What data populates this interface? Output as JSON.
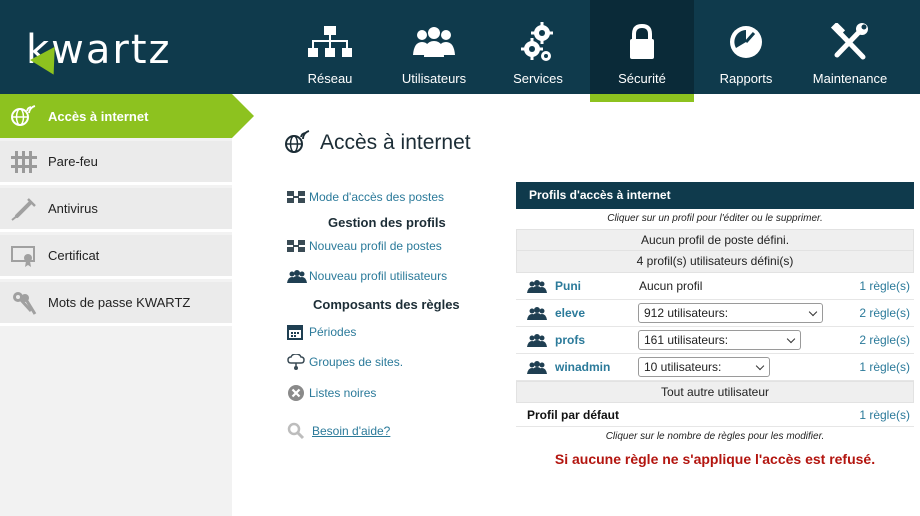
{
  "app": {
    "logo_text": "kwartz"
  },
  "nav": {
    "items": [
      {
        "label": "Réseau",
        "icon": "network-icon"
      },
      {
        "label": "Utilisateurs",
        "icon": "users-icon"
      },
      {
        "label": "Services",
        "icon": "gears-icon"
      },
      {
        "label": "Sécurité",
        "icon": "lock-icon",
        "active": true
      },
      {
        "label": "Rapports",
        "icon": "pie-chart-icon"
      },
      {
        "label": "Maintenance",
        "icon": "tools-icon"
      }
    ]
  },
  "sidebar": {
    "items": [
      {
        "label": "Accès à internet",
        "icon": "globe-icon",
        "active": true
      },
      {
        "label": "Pare-feu",
        "icon": "firewall-icon"
      },
      {
        "label": "Antivirus",
        "icon": "syringe-icon"
      },
      {
        "label": "Certificat",
        "icon": "certificate-icon"
      },
      {
        "label": "Mots de passe KWARTZ",
        "icon": "keys-icon"
      }
    ]
  },
  "page": {
    "title": "Accès à internet"
  },
  "left_menu": {
    "mode_acces": "Mode d'accès des postes",
    "gestion_title": "Gestion des profils",
    "nouveau_postes": "Nouveau profil de postes",
    "nouveau_utilisateurs": "Nouveau profil utilisateurs",
    "composants_title": "Composants des règles",
    "periodes": "Périodes",
    "groupes_sites": "Groupes de sites.",
    "listes_noires": "Listes noires",
    "aide": "Besoin d'aide?"
  },
  "profiles": {
    "title": "Profils d'accès à internet",
    "note_top": "Cliquer sur un profil pour l'éditer ou le supprimer.",
    "postes_summary": "Aucun profil de poste défini.",
    "users_summary": "4 profil(s) utilisateurs défini(s)",
    "rows": [
      {
        "name": "Puni",
        "profile": "Aucun profil",
        "rules": "1 règle(s)"
      },
      {
        "name": "eleve",
        "select": "912 utilisateurs:",
        "rules": "2 règle(s)"
      },
      {
        "name": "profs",
        "select": "161 utilisateurs:",
        "rules": "2 règle(s)"
      },
      {
        "name": "winadmin",
        "select": "10 utilisateurs:",
        "rules": "1 règle(s)"
      }
    ],
    "other_user": "Tout autre utilisateur",
    "default_label": "Profil par défaut",
    "default_rules": "1 règle(s)",
    "note_bottom": "Cliquer sur le nombre de règles pour les modifier.",
    "warning": "Si aucune règle ne s'applique l'accès est refusé."
  },
  "colors": {
    "header_bg": "#0f3a4c",
    "accent": "#8dc21f",
    "link": "#2b7a9a",
    "warning": "#b3150f"
  }
}
